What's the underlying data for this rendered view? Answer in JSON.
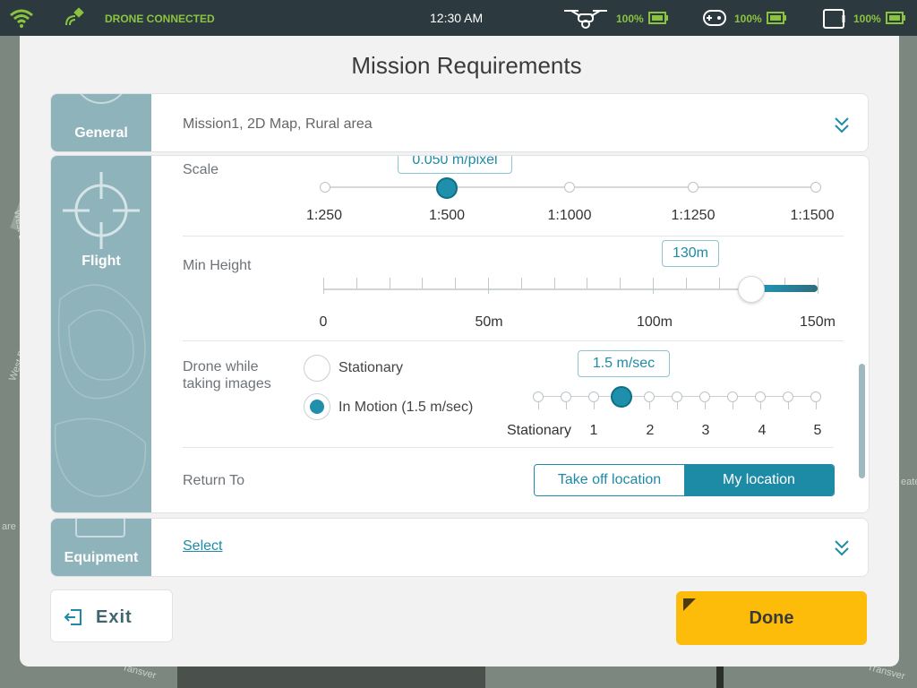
{
  "status_bar": {
    "connection": "DRONE CONNECTED",
    "time": "12:30 AM",
    "drone_battery": "100%",
    "controller_battery": "100%",
    "tablet_battery": "100%",
    "icons": [
      "wifi-icon",
      "satellite-icon",
      "drone-icon",
      "battery-icon",
      "gamepad-icon",
      "tablet-icon"
    ],
    "accent_color": "#8ac43f"
  },
  "map": {
    "labels": [
      "West D",
      "West D",
      "ransver",
      "Transver",
      "eate",
      "are"
    ]
  },
  "modal": {
    "title": "Mission Requirements",
    "general": {
      "label": "General",
      "summary": "Mission1, 2D Map, Rural area"
    },
    "flight": {
      "label": "Flight",
      "scale": {
        "label": "Scale",
        "value_text": "0.050 m/pixel",
        "options": [
          "1:250",
          "1:500",
          "1:1000",
          "1:1250",
          "1:1500"
        ],
        "selected_index": 1
      },
      "min_height": {
        "label": "Min Height",
        "value_text": "130m",
        "value": 130,
        "min": 0,
        "max": 150,
        "tick_labels": [
          "0",
          "50m",
          "100m",
          "150m"
        ]
      },
      "drone_images": {
        "label_line1": "Drone while",
        "label_line2": "taking images",
        "options": [
          "Stationary",
          "In Motion (1.5 m/sec)"
        ],
        "selected": 1,
        "speed_text": "1.5 m/sec",
        "speed_value": 1.5,
        "speed_tick_labels": [
          "Stationary",
          "1",
          "2",
          "3",
          "4",
          "5"
        ]
      },
      "return_to": {
        "label": "Return To",
        "options": [
          "Take off location",
          "My location"
        ],
        "selected": 1
      }
    },
    "equipment": {
      "label": "Equipment",
      "select_link": "Select"
    },
    "exit_label": "Exit",
    "done_label": "Done",
    "accent_color": "#1e8ba6",
    "done_color": "#fcbc09"
  }
}
